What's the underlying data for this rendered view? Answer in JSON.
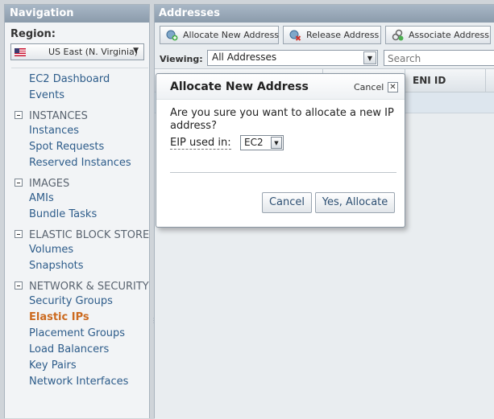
{
  "nav": {
    "header": "Navigation",
    "region_label": "Region:",
    "region_value": "US East (N. Virginia)",
    "items": [
      {
        "type": "link",
        "label": "EC2 Dashboard"
      },
      {
        "type": "link",
        "label": "Events"
      },
      {
        "type": "section",
        "label": "INSTANCES"
      },
      {
        "type": "link",
        "label": "Instances"
      },
      {
        "type": "link",
        "label": "Spot Requests"
      },
      {
        "type": "link",
        "label": "Reserved Instances"
      },
      {
        "type": "section",
        "label": "IMAGES"
      },
      {
        "type": "link",
        "label": "AMIs"
      },
      {
        "type": "link",
        "label": "Bundle Tasks"
      },
      {
        "type": "section",
        "label": "ELASTIC BLOCK STORE"
      },
      {
        "type": "link",
        "label": "Volumes"
      },
      {
        "type": "link",
        "label": "Snapshots"
      },
      {
        "type": "section",
        "label": "NETWORK & SECURITY"
      },
      {
        "type": "link",
        "label": "Security Groups"
      },
      {
        "type": "link",
        "label": "Elastic IPs",
        "active": true
      },
      {
        "type": "link",
        "label": "Placement Groups"
      },
      {
        "type": "link",
        "label": "Load Balancers"
      },
      {
        "type": "link",
        "label": "Key Pairs"
      },
      {
        "type": "link",
        "label": "Network Interfaces"
      }
    ]
  },
  "main": {
    "header": "Addresses",
    "toolbar": {
      "allocate": "Allocate New Address",
      "release": "Release Address",
      "associate": "Associate Address"
    },
    "viewing_label": "Viewing:",
    "viewing_value": "All Addresses",
    "search_placeholder": "Search",
    "columns": {
      "eni": "ENI ID"
    }
  },
  "dialog": {
    "title": "Allocate New Address",
    "cancel_link": "Cancel",
    "close_glyph": "✕",
    "question": "Are you sure you want to allocate a new IP address?",
    "eip_label": "EIP used in:",
    "eip_value": "EC2",
    "cancel_button": "Cancel",
    "confirm_button": "Yes, Allocate"
  },
  "colors": {
    "panel_header": "#8b9bab",
    "link": "#2d5c8a",
    "active_link": "#cc6a1f"
  }
}
